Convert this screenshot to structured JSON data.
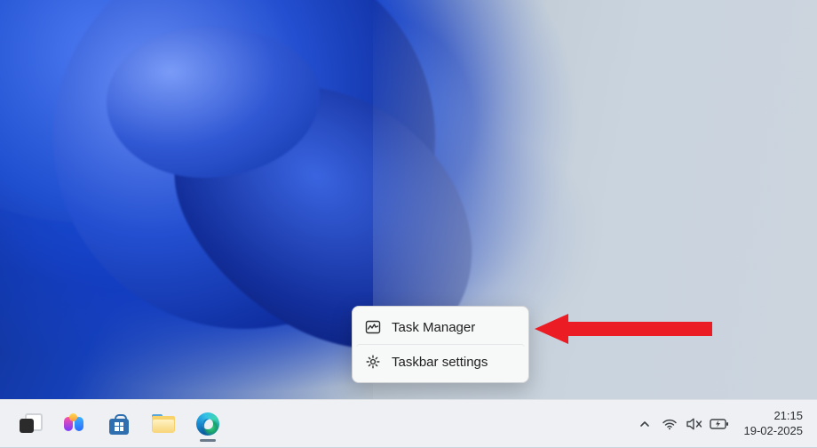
{
  "context_menu": {
    "items": [
      {
        "label": "Task Manager",
        "icon": "task-manager-icon"
      },
      {
        "label": "Taskbar settings",
        "icon": "settings-gear-icon"
      }
    ]
  },
  "taskbar": {
    "pinned": [
      {
        "name": "task-view",
        "icon": "taskview-icon"
      },
      {
        "name": "copilot",
        "icon": "copilot-icon"
      },
      {
        "name": "microsoft-store",
        "icon": "store-icon"
      },
      {
        "name": "file-explorer",
        "icon": "explorer-icon"
      },
      {
        "name": "microsoft-edge",
        "icon": "edge-icon",
        "active": true
      }
    ],
    "tray": {
      "overflow_icon": "chevron-up-icon",
      "wifi_icon": "wifi-icon",
      "volume_icon": "volume-mute-icon",
      "battery_icon": "battery-charging-icon"
    },
    "clock": {
      "time": "21:15",
      "date": "19-02-2025"
    }
  }
}
